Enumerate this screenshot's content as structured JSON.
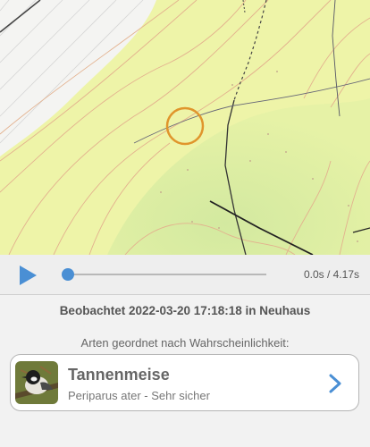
{
  "player": {
    "time_label": "0.0s / 4.17s",
    "progress": 0,
    "accent": "#4a8fd4"
  },
  "observation": {
    "text": "Beobachtet 2022-03-20 17:18:18 in Neuhaus"
  },
  "results": {
    "heading": "Arten geordnet nach Wahrscheinlichkeit:",
    "items": [
      {
        "common_name": "Tannenmeise",
        "detail": "Periparus ater - Sehr sicher",
        "icon": "bird-photo",
        "action_icon": "chevron-right-icon"
      }
    ]
  },
  "map": {
    "marker_color": "#e0952c",
    "terrain_color": "#eef4a8",
    "forest_color": "#dbeea6",
    "contour_color": "#e0b08c"
  }
}
